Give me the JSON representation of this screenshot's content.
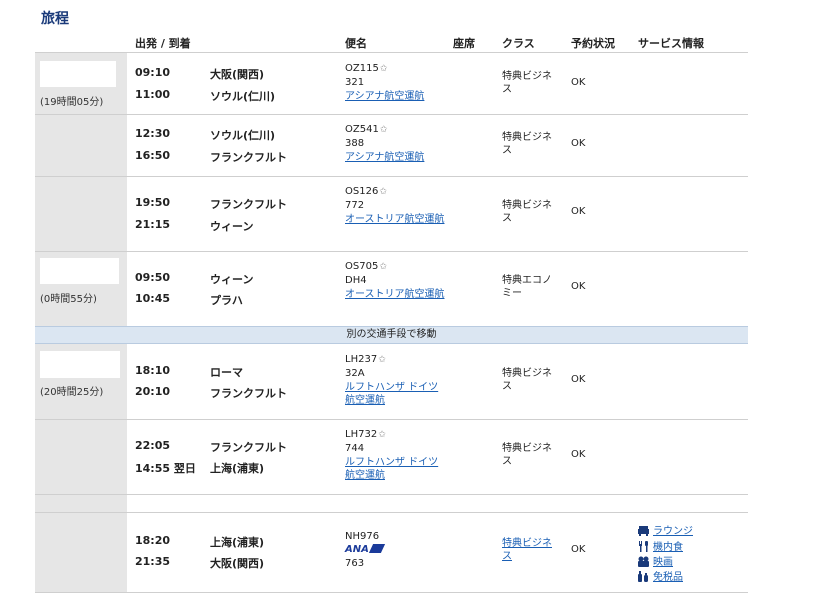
{
  "title": "旅程",
  "headers": {
    "depart_arrive": "出発 / 到着",
    "flight": "便名",
    "seat": "座席",
    "class": "クラス",
    "status": "予約状況",
    "service": "サービス情報"
  },
  "trips": [
    {
      "duration": "(19時間05分)"
    },
    {
      "duration": "(0時間55分)"
    },
    {
      "duration": "(20時間25分)"
    }
  ],
  "transfer_note": "別の交通手段で移動",
  "segments": [
    {
      "dep_time": "09:10",
      "dep_city": "大阪(関西)",
      "arr_time": "11:00",
      "arr_city": "ソウル(仁川)",
      "flight": "OZ115",
      "equipment": "321",
      "airline": "アシアナ航空運航",
      "class": "特典ビジネス",
      "status": "OK"
    },
    {
      "dep_time": "12:30",
      "dep_city": "ソウル(仁川)",
      "arr_time": "16:50",
      "arr_city": "フランクフルト",
      "flight": "OZ541",
      "equipment": "388",
      "airline": "アシアナ航空運航",
      "class": "特典ビジネス",
      "status": "OK"
    },
    {
      "dep_time": "19:50",
      "dep_city": "フランクフルト",
      "arr_time": "21:15",
      "arr_city": "ウィーン",
      "flight": "OS126",
      "equipment": "772",
      "airline": "オーストリア航空運航",
      "class": "特典ビジネス",
      "status": "OK"
    },
    {
      "dep_time": "09:50",
      "dep_city": "ウィーン",
      "arr_time": "10:45",
      "arr_city": "プラハ",
      "flight": "OS705",
      "equipment": "DH4",
      "airline": "オーストリア航空運航",
      "class": "特典エコノミー",
      "status": "OK"
    },
    {
      "dep_time": "18:10",
      "dep_city": "ローマ",
      "arr_time": "20:10",
      "arr_city": "フランクフルト",
      "flight": "LH237",
      "equipment": "32A",
      "airline": "ルフトハンザ ドイツ航空運航",
      "class": "特典ビジネス",
      "status": "OK"
    },
    {
      "dep_time": "22:05",
      "dep_city": "フランクフルト",
      "arr_time": "14:55 翌日",
      "arr_city": "上海(浦東)",
      "flight": "LH732",
      "equipment": "744",
      "airline": "ルフトハンザ ドイツ航空運航",
      "class": "特典ビジネス",
      "status": "OK"
    },
    {
      "dep_time": "18:20",
      "dep_city": "上海(浦東)",
      "arr_time": "21:35",
      "arr_city": "大阪(関西)",
      "flight": "NH976",
      "equipment": "763",
      "airline_logo": "ANA",
      "class": "特典ビジネス",
      "status": "OK"
    }
  ],
  "services": [
    {
      "icon": "lounge-icon",
      "label": "ラウンジ"
    },
    {
      "icon": "meal-icon",
      "label": "機内食"
    },
    {
      "icon": "movie-icon",
      "label": "映画"
    },
    {
      "icon": "duty-free-icon",
      "label": "免税品"
    }
  ],
  "colors": {
    "accent": "#1a3a7a",
    "link": "#1a5fb4",
    "band": "#dbe6f2",
    "side": "#e6e6e6"
  }
}
